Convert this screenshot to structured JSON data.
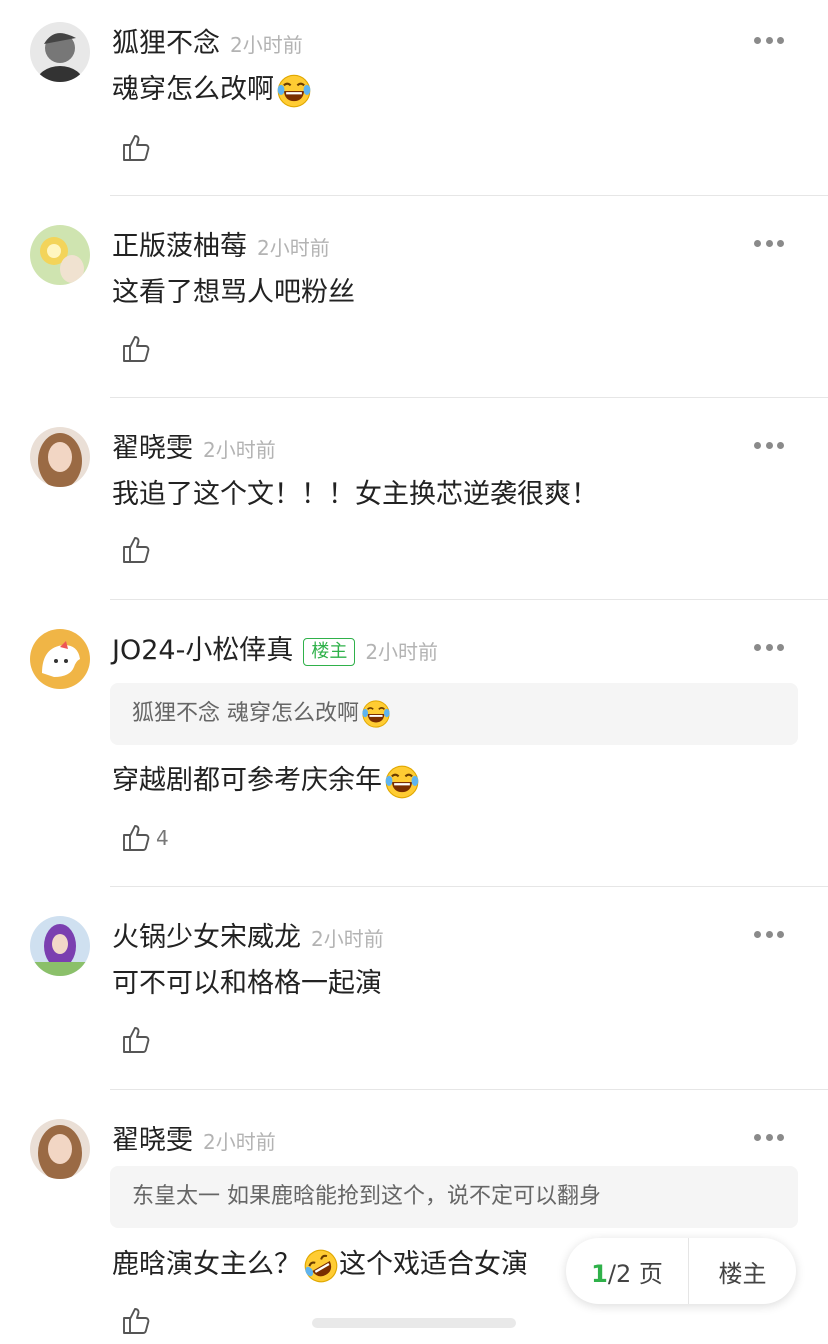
{
  "comments": [
    {
      "name": "狐狸不念",
      "time": "2小时前",
      "text": "魂穿怎么改啊",
      "emoji": "laugh-cry"
    },
    {
      "name": "正版菠柚莓",
      "time": "2小时前",
      "text": "这看了想骂人吧粉丝"
    },
    {
      "name": "翟晓雯",
      "time": "2小时前",
      "text": "我追了这个文！！！女主换芯逆袭很爽！"
    },
    {
      "name": "JO24-小松倖真",
      "badge": "楼主",
      "time": "2小时前",
      "quote": {
        "author": "狐狸不念",
        "text": "魂穿怎么改啊"
      },
      "text": "穿越剧都可参考庆余年",
      "like_count": "4"
    },
    {
      "name": "火锅少女宋威龙",
      "time": "2小时前",
      "text": "可不可以和格格一起演"
    },
    {
      "name": "翟晓雯",
      "time": "2小时前",
      "quote": {
        "author": "东皇太一",
        "text": "如果鹿晗能抢到这个，说不定可以翻身"
      },
      "text_before": "鹿晗演女主么？",
      "text_after": "这个戏适合女演"
    }
  ],
  "pager": {
    "current": "1",
    "total": "/2 页",
    "host_label": "楼主"
  },
  "colors": {
    "accent": "#2fb14a",
    "divider": "#e6e6e6",
    "quote_bg": "#f5f5f5"
  },
  "icons": [
    "more-icon",
    "thumbs-up-icon",
    "laugh-cry-emoji",
    "rofl-emoji"
  ]
}
